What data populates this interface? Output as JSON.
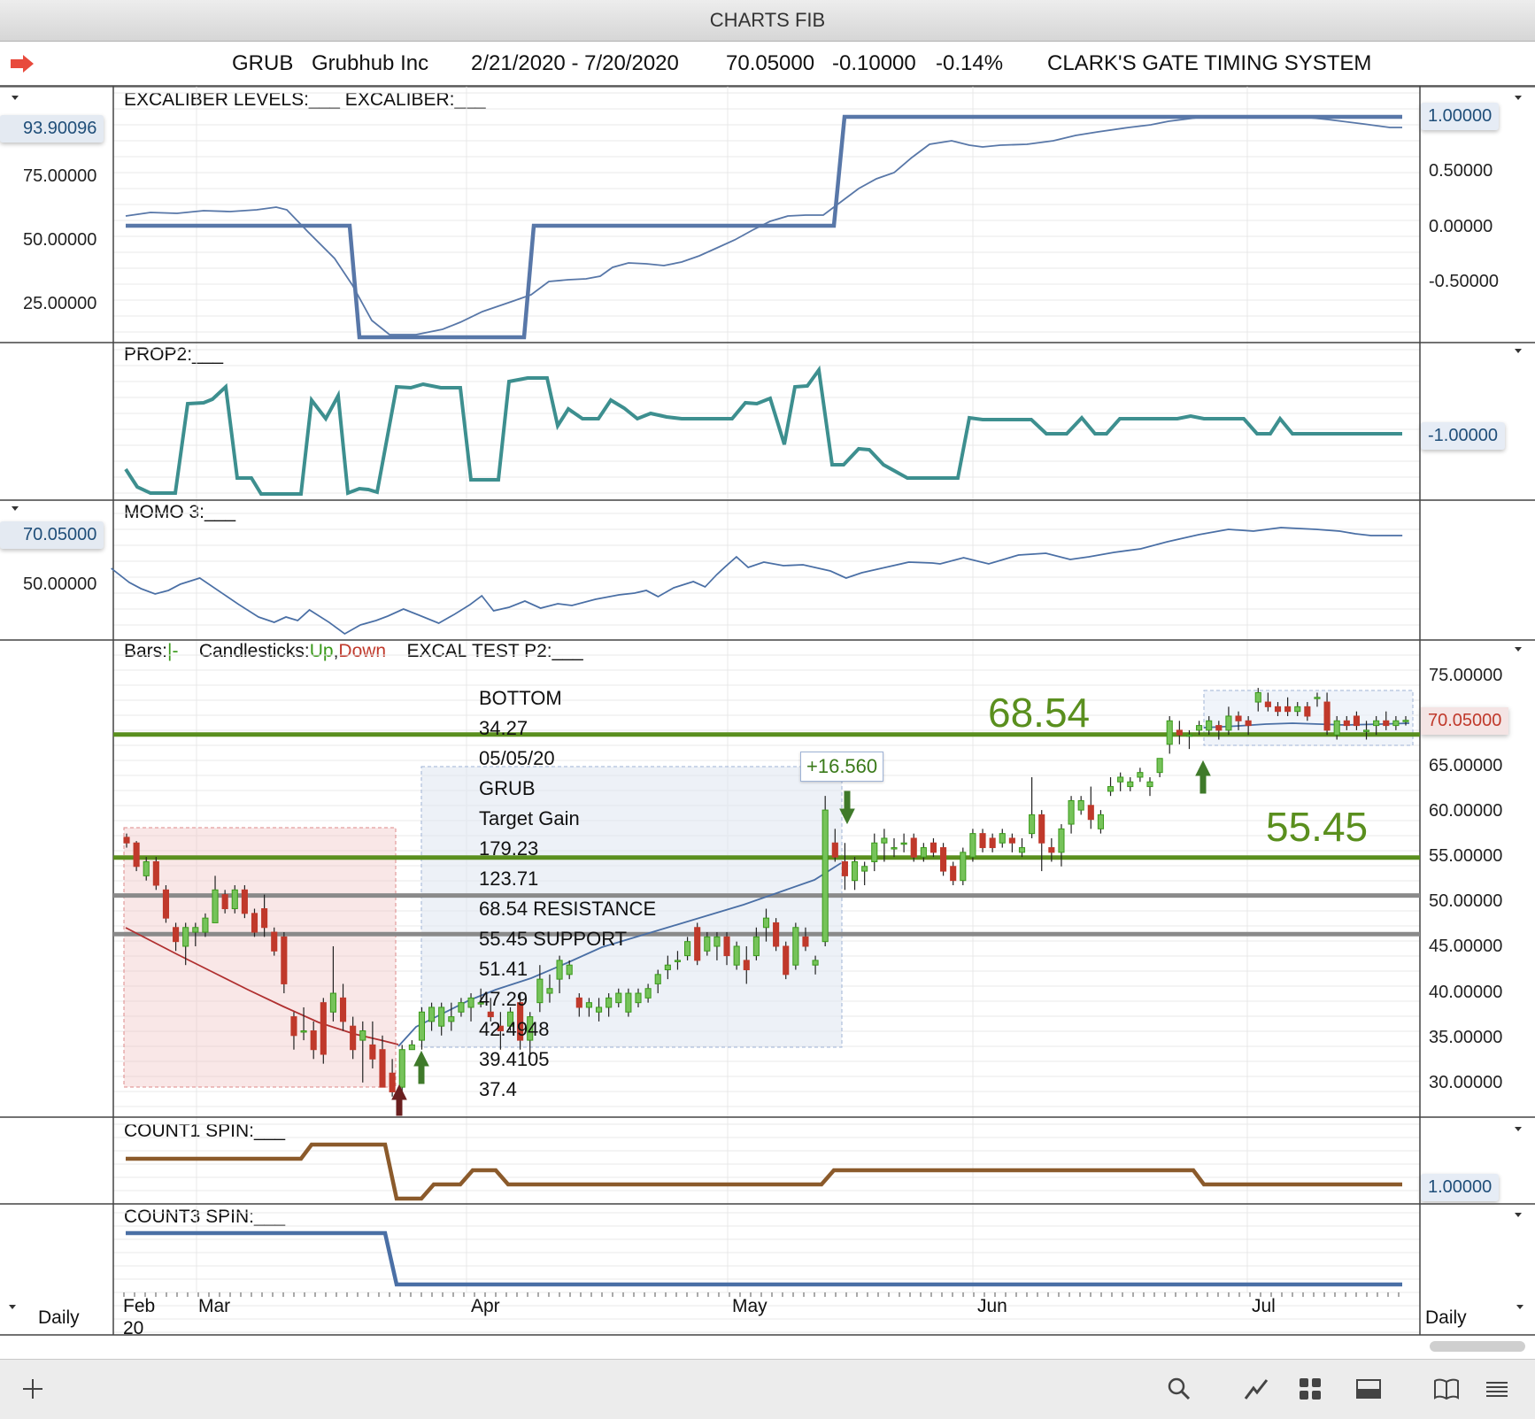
{
  "window": {
    "title": "CHARTS FIB"
  },
  "header": {
    "symbol": "GRUB",
    "company": "Grubhub Inc",
    "date_range": "2/21/2020 - 7/20/2020",
    "last": "70.05000",
    "change": "-0.10000",
    "change_pct": "-0.14%",
    "system": "CLARK'S GATE TIMING SYSTEM"
  },
  "icons": {
    "nav_arrow": "right-arrow-icon",
    "toolbar": [
      "plus-icon",
      "search-icon",
      "line-chart-icon",
      "grid-icon",
      "panel-icon",
      "book-icon",
      "menu-icon"
    ]
  },
  "colors": {
    "excal_level": "#5877a8",
    "prop2": "#3d8f8f",
    "count1": "#8b5a2b",
    "count3": "#4a6fa5",
    "up": "#3a9a1a",
    "down": "#c0392b",
    "support_line": "#5a8f1e",
    "grey_line": "#8a8a8a"
  },
  "panes": {
    "excal": {
      "label": "EXCALIBER LEVELS:___   EXCALIBER:___",
      "left_badge": "93.90096",
      "left_ticks": [
        "75.00000",
        "50.00000",
        "25.00000"
      ],
      "right_badge": "1.00000",
      "right_ticks": [
        "0.50000",
        "0.00000",
        "-0.50000"
      ]
    },
    "prop2": {
      "label": "PROP2:___",
      "right_badge": "-1.00000"
    },
    "momo": {
      "label": "MOMO 3:___",
      "left_badge": "70.05000",
      "left_ticks": [
        "50.00000"
      ]
    },
    "main": {
      "label_bars": "Bars:",
      "label_bars_val": "|-",
      "label_candles": "Candlesticks:",
      "label_up": "Up",
      "label_sep": ",",
      "label_down": "Down",
      "label_excal": "EXCAL  TEST P2:___",
      "right_ticks": [
        "75.00000",
        "65.00000",
        "60.00000",
        "55.00000",
        "50.00000",
        "45.00000",
        "40.00000",
        "35.00000",
        "30.00000"
      ],
      "price_badge": "70.05000",
      "resistance_label": "68.54",
      "support_label": "55.45",
      "gain_label": "+16.560",
      "notes": [
        "BOTTOM",
        "34.27",
        "05/05/20",
        "GRUB",
        "Target Gain",
        "179.23",
        "123.71",
        "68.54 RESISTANCE",
        "55.45 SUPPORT",
        "51.41",
        "47.29",
        "42.4948",
        "39.4105",
        "37.4"
      ]
    },
    "count1": {
      "label": "COUNT1 SPIN:___",
      "right_badge": "1.00000"
    },
    "count3": {
      "label": "COUNT3 SPIN:___"
    }
  },
  "xaxis": {
    "months": [
      "Feb",
      "Mar",
      "Apr",
      "May",
      "Jun",
      "Jul"
    ],
    "year": "20",
    "left_period": "Daily",
    "right_period": "Daily"
  },
  "chart_data": {
    "type": "candlestick",
    "title": "CHARTS FIB",
    "x_range": [
      "2020-02-21",
      "2020-07-20"
    ],
    "ylim": [
      28,
      77
    ],
    "horizontal_lines": [
      {
        "value": 68.54,
        "label": "68.54"
      },
      {
        "value": 55.45,
        "label": "55.45"
      },
      {
        "value": 51.41
      },
      {
        "value": 47.29
      }
    ],
    "candles": [
      [
        57.6,
        58.0,
        56.5,
        57.0
      ],
      [
        57.0,
        57.2,
        54.0,
        54.5
      ],
      [
        53.5,
        55.5,
        53.0,
        55.0
      ],
      [
        55.0,
        55.5,
        52.0,
        52.5
      ],
      [
        52.0,
        52.5,
        48.5,
        49.0
      ],
      [
        48.0,
        48.5,
        45.5,
        46.5
      ],
      [
        46.0,
        48.5,
        44.0,
        48.0
      ],
      [
        47.5,
        48.5,
        46.0,
        48.0
      ],
      [
        47.5,
        49.5,
        47.0,
        49.0
      ],
      [
        48.5,
        53.5,
        48.5,
        52.0
      ],
      [
        51.5,
        52.0,
        49.5,
        50.0
      ],
      [
        50.0,
        52.5,
        49.5,
        52.0
      ],
      [
        52.0,
        52.5,
        49.0,
        49.5
      ],
      [
        49.5,
        50.0,
        47.0,
        47.5
      ],
      [
        50.0,
        51.5,
        47.0,
        48.0
      ],
      [
        47.5,
        48.0,
        45.0,
        45.5
      ],
      [
        47.0,
        47.5,
        41.0,
        42.0
      ],
      [
        38.5,
        39.0,
        35.0,
        36.5
      ],
      [
        37.0,
        39.5,
        36.0,
        37.0
      ],
      [
        37.0,
        38.0,
        34.0,
        35.0
      ],
      [
        40.0,
        40.5,
        33.5,
        34.5
      ],
      [
        39.0,
        46.0,
        38.0,
        41.0
      ],
      [
        40.5,
        42.0,
        37.0,
        38.0
      ],
      [
        37.5,
        38.5,
        34.0,
        35.0
      ],
      [
        36.0,
        38.0,
        31.5,
        37.0
      ],
      [
        35.5,
        38.0,
        33.0,
        34.0
      ],
      [
        35.0,
        36.5,
        31.0,
        31.0
      ],
      [
        32.5,
        34.0,
        30.0,
        30.5
      ],
      [
        31.0,
        35.5,
        30.5,
        35.0
      ],
      [
        35.0,
        36.0,
        35.0,
        35.5
      ],
      [
        36.0,
        39.5,
        35.0,
        39.0
      ],
      [
        38.0,
        40.0,
        37.0,
        39.5
      ],
      [
        37.5,
        40.0,
        36.5,
        39.5
      ],
      [
        38.0,
        40.0,
        37.0,
        38.5
      ],
      [
        39.0,
        40.5,
        38.5,
        40.0
      ],
      [
        39.5,
        41.0,
        38.0,
        40.5
      ],
      [
        40.0,
        41.5,
        39.5,
        40.0
      ],
      [
        39.0,
        40.5,
        38.0,
        38.5
      ],
      [
        37.5,
        39.0,
        35.0,
        37.0
      ],
      [
        37.5,
        39.5,
        37.0,
        39.0
      ],
      [
        40.0,
        41.0,
        35.0,
        36.0
      ],
      [
        36.0,
        39.0,
        34.0,
        38.5
      ],
      [
        40.0,
        44.0,
        39.0,
        42.5
      ],
      [
        41.0,
        43.0,
        40.0,
        41.5
      ],
      [
        42.5,
        45.0,
        41.0,
        44.5
      ],
      [
        43.0,
        44.5,
        42.5,
        44.0
      ],
      [
        40.5,
        41.0,
        38.5,
        39.5
      ],
      [
        39.5,
        40.5,
        38.5,
        40.0
      ],
      [
        39.0,
        40.5,
        38.0,
        39.5
      ],
      [
        39.5,
        41.0,
        38.5,
        40.5
      ],
      [
        40.0,
        41.5,
        39.5,
        41.0
      ],
      [
        39.0,
        41.5,
        38.5,
        41.0
      ],
      [
        40.0,
        41.5,
        39.5,
        41.0
      ],
      [
        40.5,
        42.0,
        40.0,
        41.5
      ],
      [
        42.0,
        43.5,
        41.0,
        43.0
      ],
      [
        43.5,
        45.0,
        42.5,
        44.0
      ],
      [
        44.5,
        45.5,
        43.5,
        44.5
      ],
      [
        45.0,
        47.0,
        44.5,
        46.5
      ],
      [
        48.0,
        48.5,
        44.0,
        44.5
      ],
      [
        45.5,
        47.5,
        45.0,
        47.0
      ],
      [
        46.0,
        47.5,
        44.5,
        47.0
      ],
      [
        47.0,
        47.5,
        44.0,
        45.0
      ],
      [
        44.0,
        46.5,
        43.5,
        46.0
      ],
      [
        44.5,
        46.0,
        42.0,
        43.5
      ],
      [
        45.0,
        48.0,
        44.5,
        47.0
      ],
      [
        48.0,
        50.0,
        46.5,
        49.0
      ],
      [
        48.5,
        49.0,
        45.5,
        46.0
      ],
      [
        46.0,
        46.5,
        42.5,
        43.0
      ],
      [
        44.0,
        48.5,
        43.5,
        48.0
      ],
      [
        47.0,
        48.0,
        45.5,
        46.0
      ],
      [
        44.0,
        45.0,
        43.0,
        44.5
      ],
      [
        46.5,
        62.0,
        46.0,
        60.5
      ],
      [
        57.0,
        58.5,
        55.0,
        55.5
      ],
      [
        55.0,
        57.0,
        52.0,
        53.5
      ],
      [
        53.0,
        55.5,
        52.0,
        55.0
      ],
      [
        54.0,
        55.0,
        52.5,
        54.5
      ],
      [
        55.0,
        58.0,
        54.0,
        57.0
      ],
      [
        57.0,
        58.5,
        55.0,
        57.5
      ],
      [
        56.5,
        57.5,
        55.5,
        56.5
      ],
      [
        57.0,
        58.0,
        56.0,
        57.0
      ],
      [
        57.5,
        58.0,
        55.0,
        55.5
      ],
      [
        55.5,
        57.0,
        55.0,
        56.5
      ],
      [
        57.0,
        57.5,
        55.5,
        56.0
      ],
      [
        56.5,
        57.0,
        53.5,
        54.0
      ],
      [
        54.5,
        55.0,
        52.5,
        53.0
      ],
      [
        53.0,
        56.5,
        52.5,
        56.0
      ],
      [
        55.5,
        58.5,
        55.0,
        58.0
      ],
      [
        58.0,
        58.5,
        56.0,
        56.5
      ],
      [
        57.5,
        58.0,
        56.0,
        56.5
      ],
      [
        57.0,
        58.5,
        56.5,
        58.0
      ],
      [
        57.5,
        58.0,
        56.0,
        57.0
      ],
      [
        56.0,
        57.5,
        55.5,
        56.5
      ],
      [
        58.0,
        64.0,
        57.5,
        60.0
      ],
      [
        60.0,
        60.5,
        54.0,
        57.0
      ],
      [
        56.5,
        57.5,
        55.0,
        56.0
      ],
      [
        56.0,
        59.0,
        54.5,
        58.5
      ],
      [
        59.0,
        62.0,
        58.0,
        61.5
      ],
      [
        60.5,
        62.0,
        60.0,
        61.5
      ],
      [
        61.0,
        63.0,
        58.5,
        59.5
      ],
      [
        58.5,
        60.5,
        58.0,
        60.0
      ],
      [
        62.5,
        64.0,
        62.0,
        63.0
      ],
      [
        63.5,
        64.5,
        62.5,
        64.0
      ],
      [
        63.0,
        64.0,
        62.5,
        63.5
      ],
      [
        64.0,
        65.0,
        63.5,
        64.5
      ],
      [
        63.0,
        64.0,
        62.0,
        63.5
      ],
      [
        64.5,
        66.0,
        64.0,
        66.0
      ],
      [
        67.5,
        70.5,
        66.5,
        70.0
      ],
      [
        69.0,
        70.0,
        67.5,
        68.5
      ],
      [
        68.5,
        69.0,
        67.0,
        68.5
      ],
      [
        69.0,
        70.0,
        68.5,
        69.5
      ],
      [
        69.0,
        70.5,
        68.5,
        70.0
      ],
      [
        69.5,
        70.0,
        68.0,
        69.0
      ],
      [
        69.0,
        71.5,
        68.5,
        70.5
      ],
      [
        70.5,
        71.0,
        69.0,
        70.0
      ],
      [
        70.0,
        70.5,
        68.5,
        69.5
      ],
      [
        72.0,
        73.5,
        71.0,
        73.0
      ],
      [
        72.0,
        73.0,
        71.0,
        71.5
      ],
      [
        71.5,
        72.0,
        70.5,
        71.0
      ],
      [
        71.5,
        72.5,
        70.5,
        71.0
      ],
      [
        71.0,
        72.0,
        70.5,
        71.5
      ],
      [
        71.5,
        72.0,
        70.0,
        70.5
      ],
      [
        72.5,
        73.0,
        71.5,
        72.5
      ],
      [
        72.0,
        73.0,
        68.5,
        69.0
      ],
      [
        68.5,
        70.5,
        68.0,
        70.0
      ],
      [
        70.0,
        70.5,
        69.0,
        69.5
      ],
      [
        70.5,
        71.0,
        69.0,
        69.5
      ],
      [
        69.0,
        70.0,
        68.0,
        69.0
      ],
      [
        69.5,
        70.5,
        68.5,
        70.0
      ],
      [
        70.0,
        71.0,
        69.0,
        69.5
      ],
      [
        69.5,
        70.5,
        69.0,
        70.0
      ],
      [
        70.0,
        70.5,
        69.5,
        70.05
      ]
    ]
  }
}
